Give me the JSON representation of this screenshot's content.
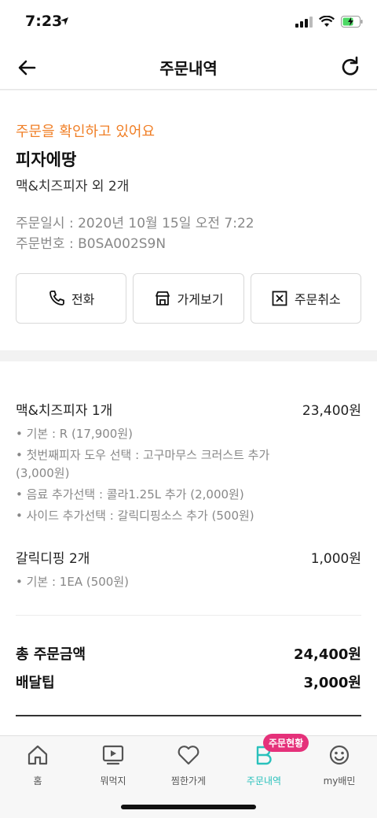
{
  "status_bar": {
    "time": "7:23"
  },
  "nav": {
    "title": "주문내역"
  },
  "summary": {
    "status_message": "주문을 확인하고 있어요",
    "store_name": "피자에땅",
    "order_summary": "맥&치즈피자 외 2개",
    "order_datetime": "주문일시 : 2020년 10월 15일 오전 7:22",
    "order_number": "주문번호 : B0SA002S9N",
    "actions": {
      "call": "전화",
      "store": "가게보기",
      "cancel": "주문취소"
    }
  },
  "items": [
    {
      "name": "맥&치즈피자 1개",
      "price": "23,400원",
      "options": [
        "• 기본 : R (17,900원)",
        "• 첫번째피자 도우 선택 : 고구마무스 크러스트 추가 (3,000원)",
        "• 음료 추가선택 : 콜라1.25L 추가 (2,000원)",
        "• 사이드 추가선택 : 갈릭디핑소스 추가 (500원)"
      ]
    },
    {
      "name": "갈릭디핑 2개",
      "price": "1,000원",
      "options": [
        "• 기본 : 1EA (500원)"
      ]
    }
  ],
  "totals": {
    "order_total_label": "총 주문금액",
    "order_total_value": "24,400원",
    "delivery_tip_label": "배달팁",
    "delivery_tip_value": "3,000원"
  },
  "tabbar": {
    "tabs": [
      {
        "label": "홈",
        "icon": "home-icon"
      },
      {
        "label": "뭐먹지",
        "icon": "play-icon"
      },
      {
        "label": "찜한가게",
        "icon": "heart-icon"
      },
      {
        "label": "주문내역",
        "icon": "order-icon"
      },
      {
        "label": "my배민",
        "icon": "smile-icon"
      }
    ],
    "badge": "주문현황"
  },
  "colors": {
    "accent_orange": "#f07f26",
    "mint": "#2ac1bc",
    "badge_pink": "#e5317a"
  }
}
